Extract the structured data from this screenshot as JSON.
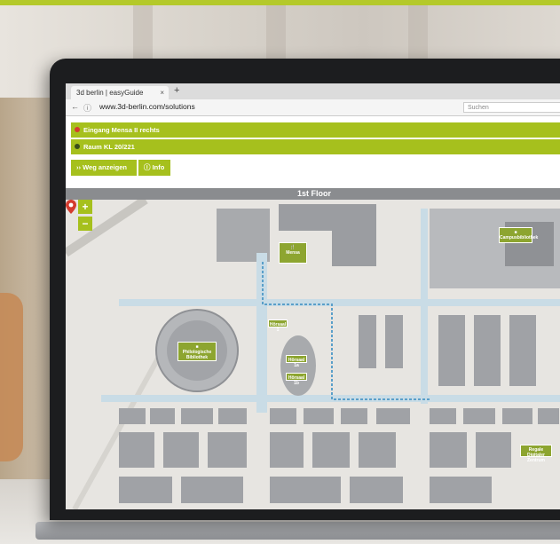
{
  "browser": {
    "tab_title": "3d berlin | easyGuide",
    "tab_close": "×",
    "new_tab": "+",
    "url": "www.3d-berlin.com/solutions",
    "search_placeholder": "Suchen"
  },
  "route": {
    "start": "Eingang Mensa II rechts",
    "destination": "Raum KL 20/221",
    "start_pin_color": "#d43c2f",
    "destination_pin_color": "#3a4f1a"
  },
  "actions": {
    "show_route": "Weg anzeigen",
    "info": "Info"
  },
  "floor": {
    "label": "1st Floor"
  },
  "zoom": {
    "in": "+",
    "out": "−"
  },
  "map_labels": {
    "mensa": "Mensa",
    "library": "Philologische Bibliothek",
    "campus_library": "Campusbibliothek",
    "hoersaal_1": "Hörsaal 1",
    "hoersaal_1a": "Hörsaal 1a",
    "hoersaal_1b": "Hörsaal 1b",
    "small_poi": "Regale Digitaler Zentrum"
  },
  "colors": {
    "accent": "#a6c01d",
    "floor_bar": "#8a8c8f",
    "map_background": "#e7e5e1",
    "building": "#9b9da1",
    "corridor": "#c9dce6"
  }
}
